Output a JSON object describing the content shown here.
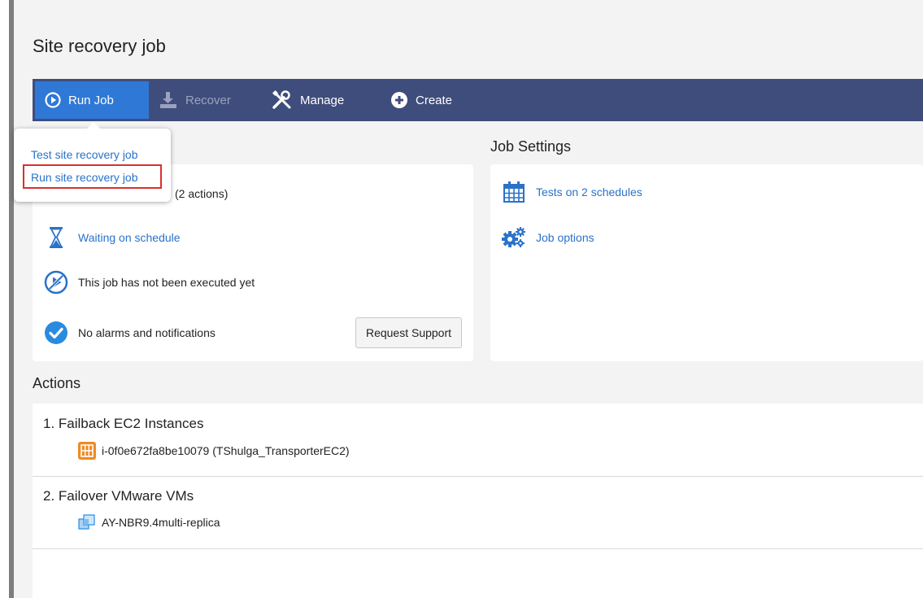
{
  "page": {
    "title": "Site recovery job"
  },
  "toolbar": {
    "run_job": "Run Job",
    "recover": "Recover",
    "manage": "Manage",
    "create": "Create"
  },
  "run_menu": {
    "items": [
      {
        "label": "Test site recovery job",
        "highlighted": false
      },
      {
        "label": "Run site recovery job",
        "highlighted": true
      }
    ]
  },
  "job_info": {
    "actions_count": "(2 actions)",
    "schedule_status": "Waiting on schedule",
    "execution_status": "This job has not been executed yet",
    "alarms_status": "No alarms and notifications",
    "request_support": "Request Support"
  },
  "job_settings": {
    "title": "Job Settings",
    "schedules": "Tests on 2 schedules",
    "options": "Job options"
  },
  "actions": {
    "title": "Actions",
    "list": [
      {
        "title": "1. Failback EC2 Instances",
        "item": "i-0f0e672fa8be10079 (TShulga_TransporterEC2)",
        "icon": "ec2-instance-icon"
      },
      {
        "title": "2. Failover VMware VMs",
        "item": "AY-NBR9.4multi-replica",
        "icon": "vmware-vm-icon"
      }
    ]
  },
  "colors": {
    "toolbar_bg": "#3f4d7c",
    "active_button": "#2f78d6",
    "link": "#2a72c8",
    "highlight": "#d9302e",
    "ec2_icon": "#f08a24"
  }
}
